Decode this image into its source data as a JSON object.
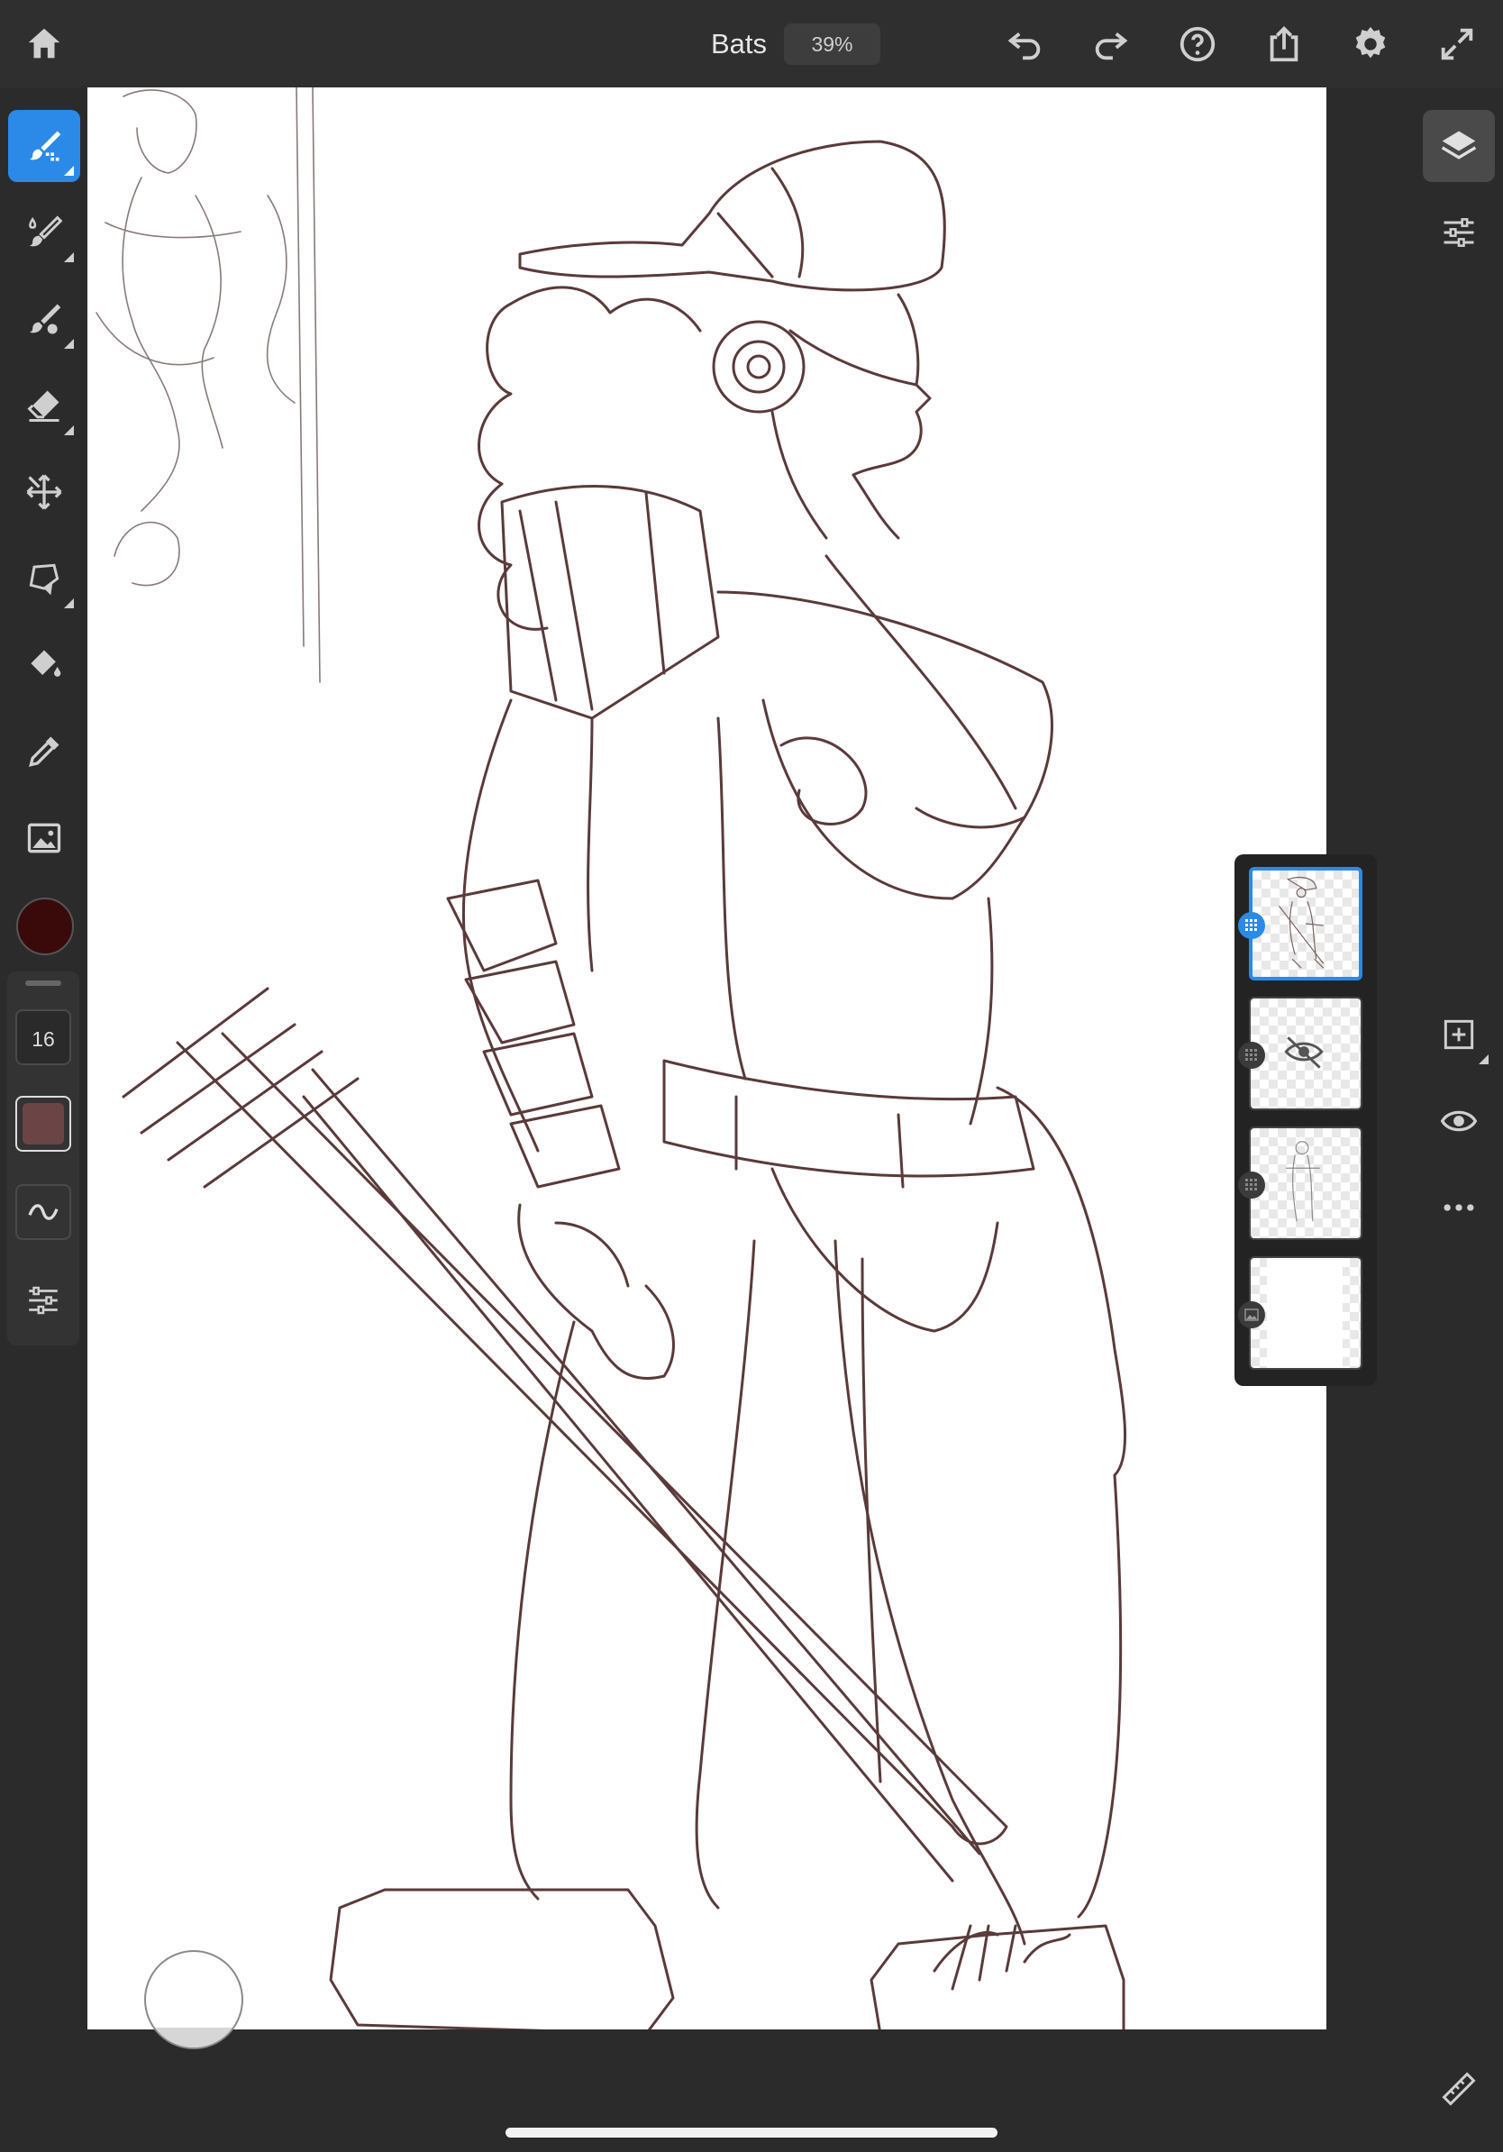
{
  "app": {
    "document_title": "Bats",
    "zoom_level": "39%"
  },
  "toolbar": {
    "icons": [
      "home-icon",
      "undo-icon",
      "redo-icon",
      "help-icon",
      "share-icon",
      "settings-icon",
      "fullscreen-icon"
    ]
  },
  "tools": {
    "items": [
      {
        "name": "pixel-brush",
        "active": true
      },
      {
        "name": "live-brush",
        "active": false
      },
      {
        "name": "mixer-brush",
        "active": false
      },
      {
        "name": "eraser",
        "active": false
      },
      {
        "name": "transform",
        "active": false
      },
      {
        "name": "selection",
        "active": false
      },
      {
        "name": "fill",
        "active": false
      },
      {
        "name": "eyedropper",
        "active": false
      },
      {
        "name": "place-image",
        "active": false
      }
    ],
    "current_color": "#3a0a0a",
    "brush_size": "16",
    "opacity_color": "#6b4545"
  },
  "right_tools": {
    "icons": [
      "layers-icon",
      "layer-properties-icon",
      "add-layer-icon",
      "visibility-icon",
      "more-icon",
      "ruler-icon"
    ]
  },
  "layers": [
    {
      "kind": "pixel",
      "selected": true,
      "visible": true
    },
    {
      "kind": "pixel",
      "selected": false,
      "visible": false
    },
    {
      "kind": "pixel",
      "selected": false,
      "visible": true
    },
    {
      "kind": "image",
      "selected": false,
      "visible": true
    }
  ],
  "colors": {
    "accent": "#2b8ae8",
    "sketch_ink": "#5a3a3a",
    "panel": "#2b2b2b"
  }
}
